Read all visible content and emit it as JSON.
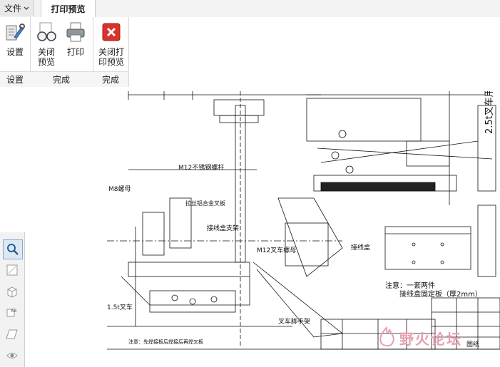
{
  "menu": {
    "file_label": "文件",
    "active_tab": "打印预览"
  },
  "ribbon": {
    "groups": [
      {
        "label": "设置",
        "buttons": [
          {
            "label": "设置",
            "icon": "wrench-settings-icon"
          }
        ]
      },
      {
        "label": "完成",
        "buttons": [
          {
            "label": "关闭\n预览",
            "icon": "glasses-icon"
          },
          {
            "label": "打印",
            "icon": "printer-icon"
          }
        ]
      },
      {
        "label": "完成",
        "buttons": [
          {
            "label": "关闭打\n印预览",
            "icon": "close-x-icon"
          }
        ]
      }
    ]
  },
  "left_tools": [
    "zoom-icon",
    "select-icon",
    "box-icon",
    "text-icon",
    "shape-icon",
    "eye-icon"
  ],
  "drawing": {
    "notes": {
      "n1": "注意：一套两件",
      "n2": "接线盒固定板（厚2mm）",
      "n3": "2.5t叉车用",
      "n4": "M12叉车螺母",
      "n5": "接线盒支架",
      "n6": "M8螺母",
      "n7": "注意：先焊接板后焊接后再焊叉板",
      "n8": "拉丝铝合金叉板",
      "n9": "M12不锈钢螺杆",
      "n10": "1.5t叉车",
      "n11": "叉车脚手架",
      "n12": "接线盒"
    },
    "title_block": {
      "label": "图纸"
    }
  },
  "watermark": {
    "text": "野火论坛"
  },
  "colors": {
    "accent": "#d9322b",
    "ribbon_bg": "#ffffff",
    "watermark": "#e7a0b0"
  }
}
